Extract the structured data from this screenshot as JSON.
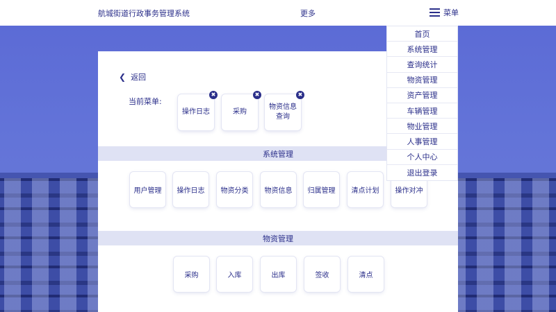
{
  "header": {
    "title": "航城街道行政事务管理系统",
    "more_label": "更多",
    "menu_label": "菜单"
  },
  "card": {
    "back_label": "返回",
    "current_menu_label": "当前菜单:",
    "current_items": [
      "操作日志",
      "采购",
      "物资信息查询"
    ],
    "remove_glyph": "✖",
    "sections": [
      {
        "title": "系统管理",
        "items": [
          "用户管理",
          "操作日志",
          "物资分类",
          "物资信息",
          "归属管理",
          "清点计划",
          "操作对冲"
        ]
      },
      {
        "title": "物资管理",
        "items": [
          "采购",
          "入库",
          "出库",
          "签收",
          "清点"
        ]
      }
    ]
  },
  "dropdown": {
    "items": [
      "首页",
      "系统管理",
      "查询统计",
      "物资管理",
      "资产管理",
      "车辆管理",
      "物业管理",
      "人事管理",
      "个人中心",
      "退出登录"
    ]
  },
  "colors": {
    "primary_text": "#2b2f8a",
    "section_bar": "#dfe2f4",
    "background_blue": "#5c6bd6"
  },
  "icons": {
    "menu": "hamburger-icon",
    "back": "chevron-left-icon",
    "remove": "close-icon"
  }
}
